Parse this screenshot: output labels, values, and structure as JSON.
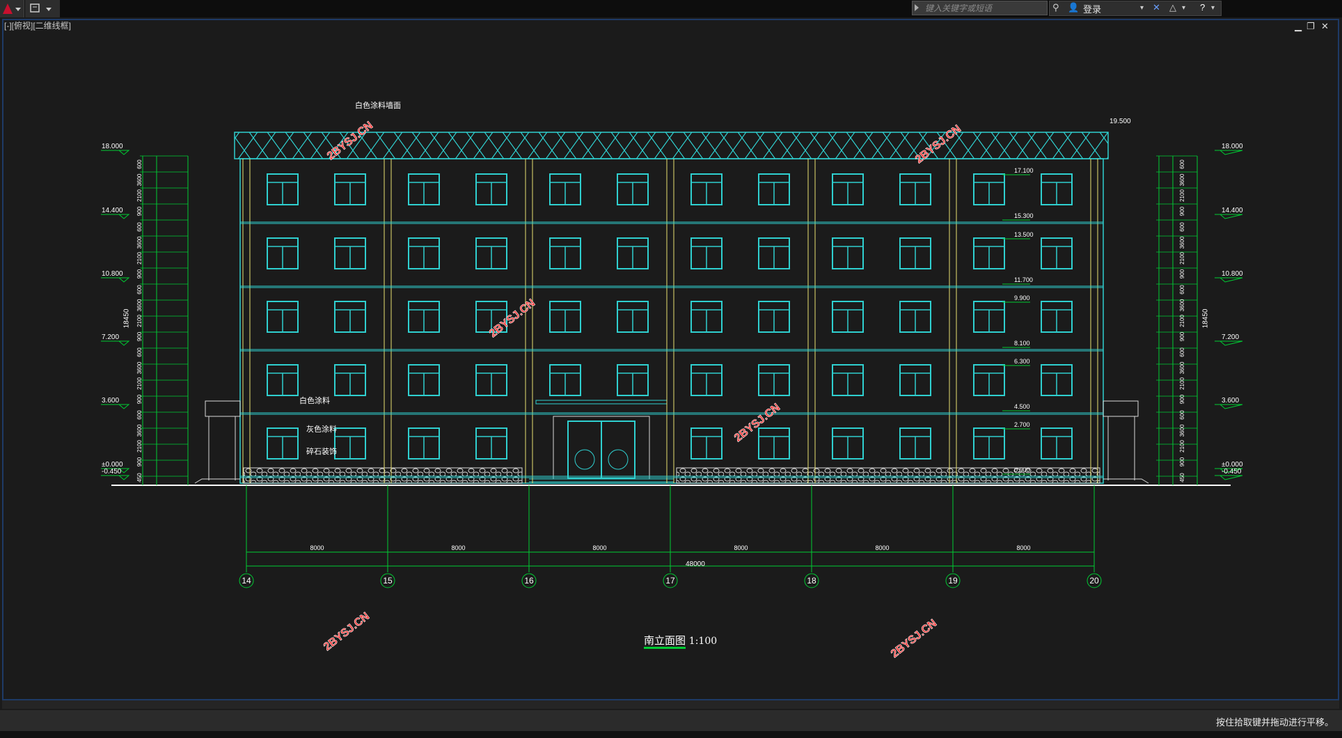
{
  "app": {
    "search_placeholder": "键入关键字或短语",
    "login_label": "登录",
    "viewport_label": "[-][俯视][二维线框]",
    "status_text": "按住拾取键并拖动进行平移。"
  },
  "drawing": {
    "title": "南立面图",
    "scale": "1:100",
    "watermark": "2BYSJ.CN",
    "axes": [
      "14",
      "15",
      "16",
      "17",
      "18",
      "19",
      "20"
    ],
    "bay_dims": [
      "8000",
      "8000",
      "8000",
      "8000",
      "8000",
      "8000"
    ],
    "total_dim": "48000",
    "left_levels": [
      "18.000",
      "14.400",
      "10.800",
      "7.200",
      "3.600",
      "±0.000",
      "-0.450"
    ],
    "right_levels": [
      "18.000",
      "14.400",
      "10.800",
      "7.200",
      "3.600",
      "±0.000",
      "-0.450"
    ],
    "roof_level": "19.500",
    "total_height": "18450",
    "annotations": [
      "白色涂料墙面",
      "白色涂料",
      "灰色涂料",
      "碎石装饰"
    ],
    "window_marks": [
      "17.100",
      "15.300",
      "13.500",
      "11.700",
      "9.900",
      "8.100",
      "6.300",
      "4.500",
      "2.700",
      "0.900"
    ],
    "dim_chain_left": [
      "600",
      "3600",
      "2100",
      "900",
      "600",
      "3600",
      "2100",
      "900",
      "600",
      "3600",
      "2100",
      "900",
      "600",
      "3600",
      "2100",
      "900",
      "600",
      "3600",
      "2100",
      "900",
      "450"
    ]
  }
}
